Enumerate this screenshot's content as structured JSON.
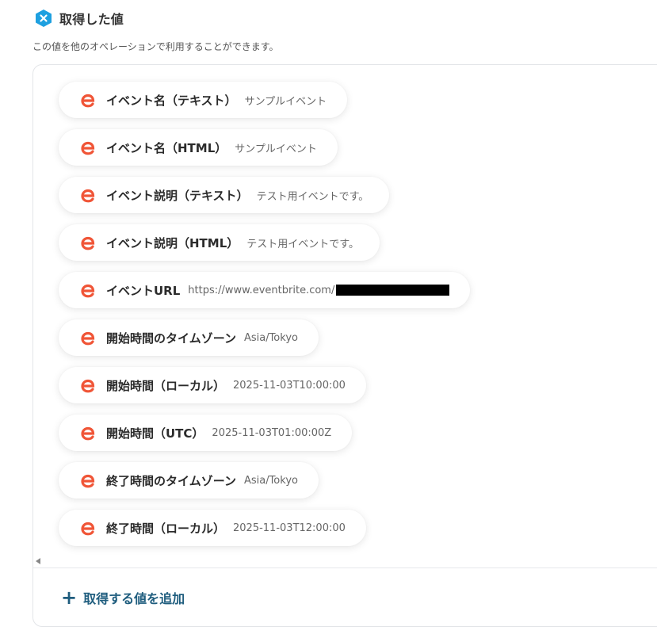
{
  "header": {
    "title": "取得した値",
    "subtitle": "この値を他のオペレーションで利用することができます。",
    "icon": "crossed-hexagon-icon"
  },
  "colors": {
    "brand": "#1ea0e0",
    "eventbrite": "#f05537",
    "accent": "#1f5d7e"
  },
  "items": [
    {
      "label": "イベント名（テキスト）",
      "value": "サンプルイベント",
      "icon": "eventbrite-icon"
    },
    {
      "label": "イベント名（HTML）",
      "value": "サンプルイベント",
      "icon": "eventbrite-icon"
    },
    {
      "label": "イベント説明（テキスト）",
      "value": "テスト用イベントです。",
      "icon": "eventbrite-icon"
    },
    {
      "label": "イベント説明（HTML）",
      "value": "テスト用イベントです。",
      "icon": "eventbrite-icon"
    },
    {
      "label": "イベントURL",
      "value": "https://www.eventbrite.com/",
      "icon": "eventbrite-icon",
      "redacted": true
    },
    {
      "label": "開始時間のタイムゾーン",
      "value": "Asia/Tokyo",
      "icon": "eventbrite-icon"
    },
    {
      "label": "開始時間（ローカル）",
      "value": "2025-11-03T10:00:00",
      "icon": "eventbrite-icon"
    },
    {
      "label": "開始時間（UTC）",
      "value": "2025-11-03T01:00:00Z",
      "icon": "eventbrite-icon"
    },
    {
      "label": "終了時間のタイムゾーン",
      "value": "Asia/Tokyo",
      "icon": "eventbrite-icon"
    },
    {
      "label": "終了時間（ローカル）",
      "value": "2025-11-03T12:00:00",
      "icon": "eventbrite-icon"
    }
  ],
  "add_button": {
    "label": "取得する値を追加",
    "icon": "plus-icon"
  }
}
